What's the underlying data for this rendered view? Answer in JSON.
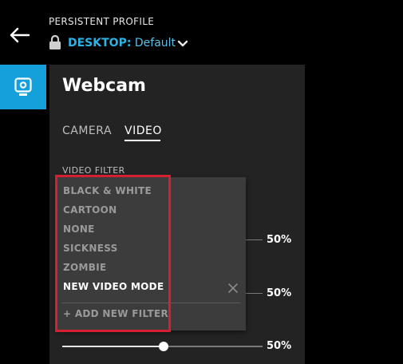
{
  "header": {
    "profile_label": "PERSISTENT PROFILE",
    "profile_device": "DESKTOP:",
    "profile_name": "Default"
  },
  "panel": {
    "title": "Webcam",
    "tabs": [
      {
        "label": "CAMERA",
        "active": false
      },
      {
        "label": "VIDEO",
        "active": true
      }
    ],
    "video_filter_label": "VIDEO FILTER",
    "sliders": [
      {
        "value_label": "50%",
        "level": 0.5
      },
      {
        "value_label": "50%",
        "level": 0.5
      },
      {
        "value_label": "50%",
        "level": 0.5
      }
    ]
  },
  "dropdown": {
    "options": [
      {
        "label": "BLACK & WHITE",
        "selected": false
      },
      {
        "label": "CARTOON",
        "selected": false
      },
      {
        "label": "NONE",
        "selected": false
      },
      {
        "label": "SICKNESS",
        "selected": false
      },
      {
        "label": "ZOMBIE",
        "selected": false
      },
      {
        "label": "NEW VIDEO MODE",
        "selected": true
      }
    ],
    "add_label": "+ ADD NEW FILTER"
  },
  "colors": {
    "accent": "#16a0db",
    "link": "#2bb3e6",
    "highlight": "#d42030",
    "panel": "#232323",
    "dropdown": "#3c3c3c"
  },
  "icons": {
    "back": "arrow-left-icon",
    "lock": "lock-icon",
    "profile_chevron": "chevron-down-icon",
    "webcam": "webcam-icon",
    "close": "close-icon"
  }
}
